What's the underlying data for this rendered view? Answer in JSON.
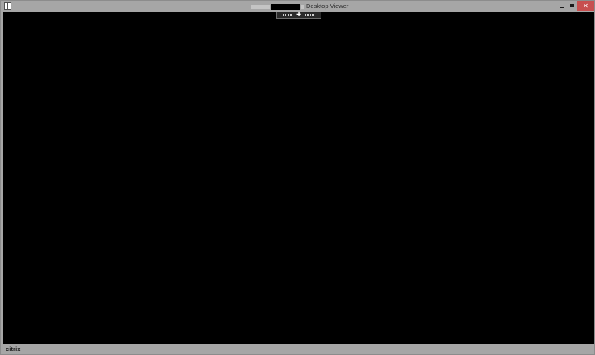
{
  "window": {
    "title": "Desktop Viewer",
    "buttons": {
      "minimize": "–",
      "maximize": "□",
      "close": "✕"
    }
  },
  "toolbar": {
    "handle_glyph": "✚"
  },
  "statusbar": {
    "brand": "citrix"
  },
  "colors": {
    "chrome": "#a6a6a6",
    "desktop": "#000000",
    "close_button": "#c75050"
  },
  "icons": {
    "app": "window-app-icon",
    "toolbar_left": "grip-icon",
    "toolbar_center": "move-icon",
    "toolbar_right": "grip-icon"
  }
}
